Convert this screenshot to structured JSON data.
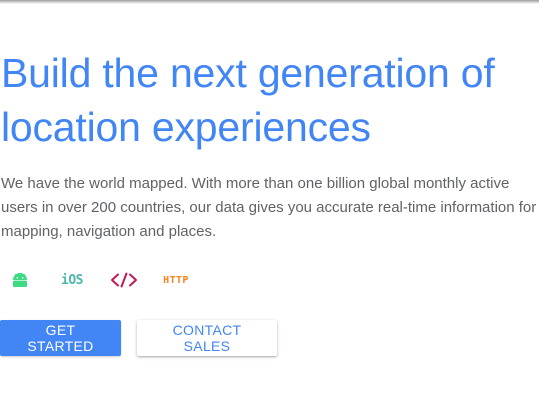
{
  "hero": {
    "headline_line1": "Build the next generation of",
    "headline_line2": "location experiences",
    "description_line1": "We have the world mapped. With more than one billion global monthly active",
    "description_line2": "users in over 200 countries, our data gives you accurate real-time information for",
    "description_line3": "mapping, navigation and places."
  },
  "platforms": {
    "android_icon": "android-icon",
    "ios_label": "iOS",
    "web_icon": "code-icon",
    "http_label": "HTTP"
  },
  "actions": {
    "primary_label": "GET STARTED",
    "secondary_label": "CONTACT SALES"
  },
  "colors": {
    "accent": "#4285f4",
    "text": "#5f6368",
    "android": "#3ddc84",
    "ios": "#4db6ac",
    "web": "#c2185b",
    "http": "#f4831f"
  }
}
